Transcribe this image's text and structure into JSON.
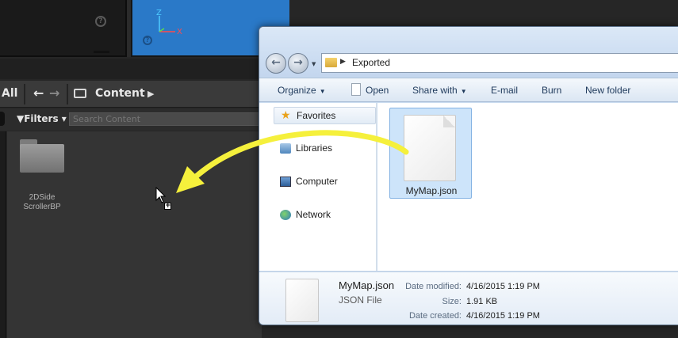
{
  "unreal": {
    "viewport_axes": {
      "z": "Z",
      "x": "X"
    },
    "nav": {
      "all_label": "All",
      "breadcrumb": "Content"
    },
    "filters_label": "Filters",
    "search_placeholder": "Search Content",
    "asset": {
      "line1": "2DSide",
      "line2": "ScrollerBP"
    }
  },
  "explorer": {
    "path": "Exported",
    "toolbar": {
      "organize": "Organize",
      "open": "Open",
      "share_with": "Share with",
      "email": "E-mail",
      "burn": "Burn",
      "new_folder": "New folder"
    },
    "nav_pane": {
      "favorites": "Favorites",
      "libraries": "Libraries",
      "computer": "Computer",
      "network": "Network"
    },
    "file": {
      "name": "MyMap.json"
    },
    "details": {
      "name": "MyMap.json",
      "type": "JSON File",
      "date_modified_label": "Date modified:",
      "date_modified": "4/16/2015 1:19 PM",
      "size_label": "Size:",
      "size": "1.91 KB",
      "date_created_label": "Date created:",
      "date_created": "4/16/2015 1:19 PM"
    }
  },
  "colors": {
    "ue_viewport": "#2a79c8",
    "drag_arrow": "#f5f03c",
    "selection": "#cde4fa"
  }
}
